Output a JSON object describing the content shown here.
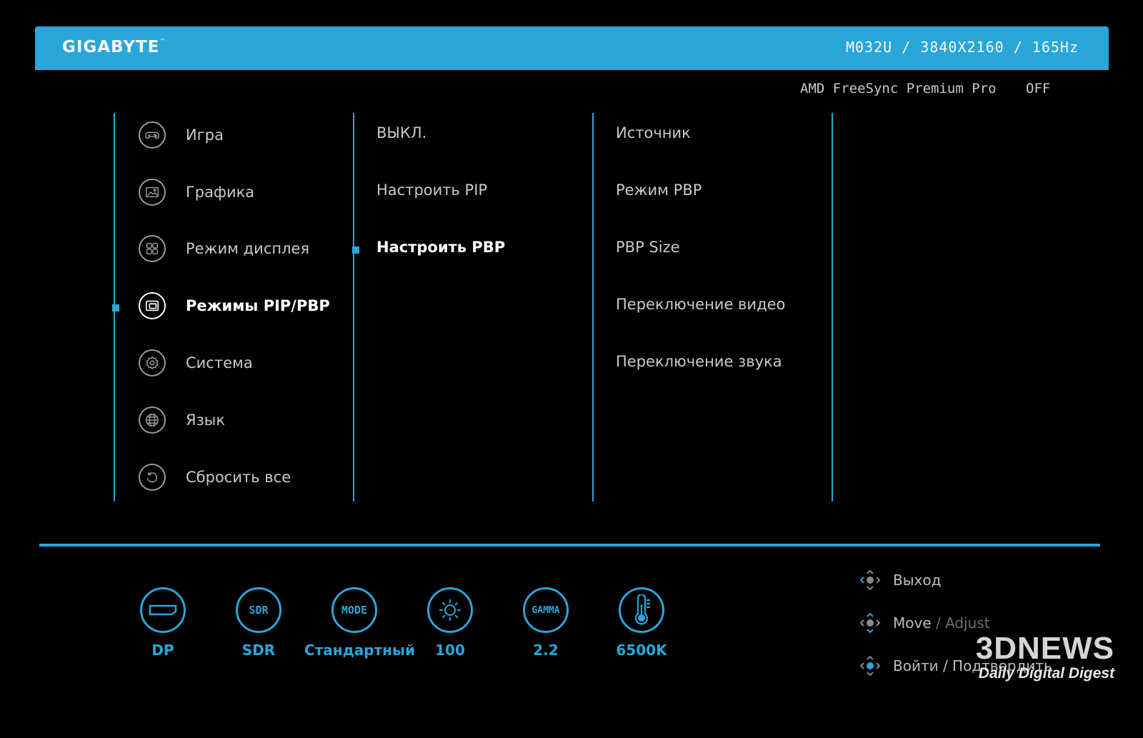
{
  "header": {
    "brand": "GIGABYTE",
    "brand_tm": "™",
    "model_info": "M032U / 3840X2160 / 165Hz"
  },
  "freesync": {
    "label": "AMD FreeSync Premium Pro",
    "value": "OFF"
  },
  "main_menu": {
    "items": [
      {
        "label": "Игра",
        "icon": "gamepad-icon"
      },
      {
        "label": "Графика",
        "icon": "picture-icon"
      },
      {
        "label": "Режим дисплея",
        "icon": "grid-icon"
      },
      {
        "label": "Режимы PIP/PBP",
        "icon": "pip-icon",
        "selected": true
      },
      {
        "label": "Система",
        "icon": "gear-icon"
      },
      {
        "label": "Язык",
        "icon": "globe-icon"
      },
      {
        "label": "Сбросить все",
        "icon": "reset-icon"
      }
    ]
  },
  "submenu": {
    "items": [
      {
        "label": "ВЫКЛ."
      },
      {
        "label": "Настроить PIP"
      },
      {
        "label": "Настроить PBP",
        "selected": true
      }
    ]
  },
  "options": {
    "items": [
      {
        "label": "Источник"
      },
      {
        "label": "Режим PBP"
      },
      {
        "label": "PBP Size"
      },
      {
        "label": "Переключение видео"
      },
      {
        "label": "Переключение звука"
      }
    ]
  },
  "status_bar": {
    "items": [
      {
        "icon": "displayport-icon",
        "value": "DP"
      },
      {
        "icon_text": "SDR",
        "value": "SDR"
      },
      {
        "icon_text": "MODE",
        "value": "Стандартный"
      },
      {
        "icon": "brightness-icon",
        "value": "100"
      },
      {
        "icon_text": "GAMMA",
        "value": "2.2"
      },
      {
        "icon": "thermometer-icon",
        "value": "6500K"
      }
    ]
  },
  "hints": {
    "exit": "Выход",
    "move": "Move",
    "adjust": "/ Adjust",
    "enter": "Войти / Подтвердить"
  },
  "watermark": {
    "logo": "3DNEWS",
    "tagline": "Daily Digital Digest"
  },
  "colors": {
    "accent": "#2aa6d9",
    "background": "#000000",
    "text": "#c9c9c9",
    "selected_text": "#ffffff"
  }
}
